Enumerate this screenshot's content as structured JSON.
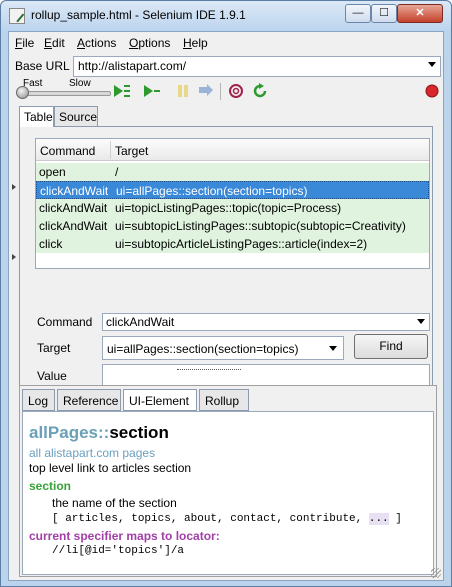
{
  "window": {
    "title": "rollup_sample.html - Selenium IDE 1.9.1",
    "minimize_glyph": "—",
    "maximize_glyph": "☐",
    "close_glyph": "✕"
  },
  "menu": {
    "items": [
      {
        "label": "File",
        "accel": "F"
      },
      {
        "label": "Edit",
        "accel": "E"
      },
      {
        "label": "Actions",
        "accel": "A"
      },
      {
        "label": "Options",
        "accel": "O"
      },
      {
        "label": "Help",
        "accel": "H"
      }
    ]
  },
  "base_url": {
    "label": "Base URL",
    "value": "http://alistapart.com/"
  },
  "toolbar": {
    "fast_label": "Fast",
    "slow_label": "Slow",
    "icons": [
      "play-suite-icon",
      "play-test-icon",
      "pause-icon",
      "step-icon",
      "rollup-icon",
      "record-icon"
    ]
  },
  "top_tabs": [
    "Table",
    "Source"
  ],
  "grid": {
    "headers": [
      "Command",
      "Target"
    ],
    "rows": [
      {
        "command": "open",
        "target": "/"
      },
      {
        "command": "clickAndWait",
        "target": "ui=allPages::section(section=topics)"
      },
      {
        "command": "clickAndWait",
        "target": "ui=topicListingPages::topic(topic=Process)"
      },
      {
        "command": "clickAndWait",
        "target": "ui=subtopicListingPages::subtopic(subtopic=Creativity)"
      },
      {
        "command": "click",
        "target": "ui=subtopicArticleListingPages::article(index=2)"
      }
    ],
    "selected_index": 1
  },
  "editor": {
    "command_label": "Command",
    "command_value": "clickAndWait",
    "target_label": "Target",
    "target_value": "ui=allPages::section(section=topics)",
    "find_label": "Find",
    "value_label": "Value",
    "value_value": ""
  },
  "bottom_tabs": [
    "Log",
    "Reference",
    "UI-Element",
    "Rollup"
  ],
  "ui_element": {
    "namespace": "allPages::",
    "name": "section",
    "pageset": "all alistapart.com pages",
    "description": "top level link to articles section",
    "arg_name": "section",
    "arg_description": "the name of the section",
    "arg_values_prefix": "[ articles, topics, about, contact, contribute, ",
    "arg_values_more": "...",
    "arg_values_suffix": " ]",
    "locator_heading": "current specifier maps to locator:",
    "locator_value": "//li[@id='topics']/a"
  }
}
